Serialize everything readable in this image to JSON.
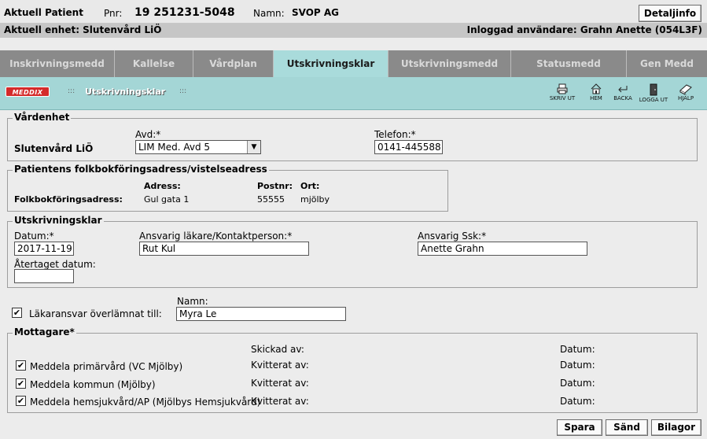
{
  "header": {
    "patient_label": "Aktuell Patient",
    "pnr_label": "Pnr:",
    "pnr_value": "19 251231-5048",
    "name_label": "Namn:",
    "name_value": "SVOP AG",
    "details_button": "Detaljinfo",
    "unit_text": "Aktuell enhet: Slutenvård LiÖ",
    "user_text": "Inloggad användare: Grahn Anette (054L3F)"
  },
  "tabs": [
    {
      "label": "Inskrivningsmedd"
    },
    {
      "label": "Kallelse"
    },
    {
      "label": "Vårdplan"
    },
    {
      "label": "Utskrivningsklar"
    },
    {
      "label": "Utskrivningsmedd"
    },
    {
      "label": "Statusmedd"
    },
    {
      "label": "Gen Medd"
    }
  ],
  "toolbar": {
    "logo": "MEDDIX",
    "title": "Utskrivningsklar",
    "grip": ":::",
    "tools": [
      {
        "label": "SKRIV UT",
        "icon": "printer-icon"
      },
      {
        "label": "HEM",
        "icon": "home-icon"
      },
      {
        "label": "BACKA",
        "icon": "back-arrow-icon"
      },
      {
        "label": "LOGGA UT",
        "icon": "logout-door-icon"
      },
      {
        "label": "HJÄLP",
        "icon": "help-book-icon"
      }
    ]
  },
  "vardenhet": {
    "legend": "Vårdenhet",
    "unit_name": "Slutenvård LiÖ",
    "avd_label": "Avd:*",
    "avd_value": "LIM Med. Avd 5",
    "telefon_label": "Telefon:*",
    "telefon_value": "0141-445588"
  },
  "adress": {
    "legend": "Patientens folkbokföringsadress/vistelseadress",
    "row_label": "Folkbokföringsadress:",
    "adress_label": "Adress:",
    "adress_value": "Gul gata 1",
    "postnr_label": "Postnr:",
    "postnr_value": "55555",
    "ort_label": "Ort:",
    "ort_value": "mjölby"
  },
  "utskrivningsklar": {
    "legend": "Utskrivningsklar",
    "datum_label": "Datum:*",
    "datum_value": "2017-11-19",
    "lakare_label": "Ansvarig läkare/Kontaktperson:*",
    "lakare_value": "Rut Kul",
    "ssk_label": "Ansvarig Ssk:*",
    "ssk_value": "Anette Grahn",
    "atertaget_label": "Återtaget datum:",
    "atertaget_value": ""
  },
  "lakaransvar": {
    "checked": true,
    "label": "Läkaransvar överlämnat till:",
    "namn_label": "Namn:",
    "namn_value": "Myra Le"
  },
  "mottagare": {
    "legend": "Mottagare*",
    "skickad_label": "Skickad av:",
    "datum_header": "Datum:",
    "rows": [
      {
        "label": "Meddela primärvård (VC Mjölby)",
        "checked": true,
        "kvitterat": "Kvitterat av:",
        "datum": "Datum:"
      },
      {
        "label": "Meddela kommun (Mjölby)",
        "checked": true,
        "kvitterat": "Kvitterat av:",
        "datum": "Datum:"
      },
      {
        "label": "Meddela hemsjukvård/AP (Mjölbys Hemsjukvård)",
        "checked": true,
        "kvitterat": "Kvitterat av:",
        "datum": "Datum:"
      }
    ]
  },
  "footer": {
    "save": "Spara",
    "send": "Sänd",
    "attachments": "Bilagor"
  },
  "colors": {
    "active_tab": "#a9dbdb",
    "toolbar_bg": "#a4d6d6",
    "tab_bar": "#8a8a8a"
  }
}
